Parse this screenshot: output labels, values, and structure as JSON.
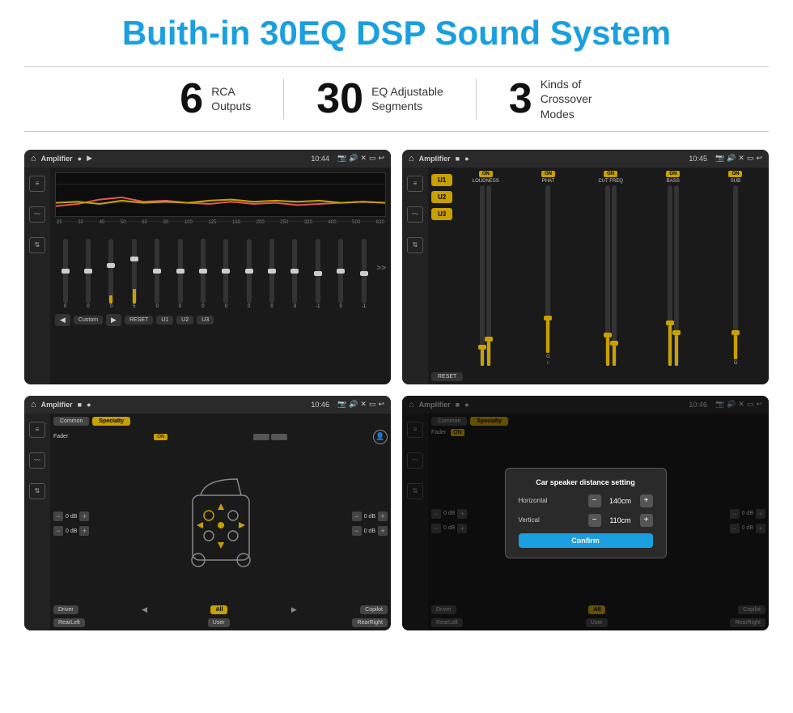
{
  "title": "Buith-in 30EQ DSP Sound System",
  "stats": [
    {
      "number": "6",
      "text": "RCA\nOutputs"
    },
    {
      "number": "30",
      "text": "EQ Adjustable\nSegments"
    },
    {
      "number": "3",
      "text": "Kinds of\nCrossover Modes"
    }
  ],
  "screen1": {
    "topbar": {
      "title": "Amplifier",
      "time": "10:44"
    },
    "eq_labels": [
      "25",
      "32",
      "40",
      "50",
      "63",
      "80",
      "100",
      "125",
      "160",
      "200",
      "250",
      "320",
      "400",
      "500",
      "630"
    ],
    "eq_values": [
      "0",
      "0",
      "0",
      "5",
      "0",
      "0",
      "0",
      "0",
      "0",
      "0",
      "0",
      "-1",
      "0",
      "-1"
    ],
    "buttons": [
      "Custom",
      "RESET",
      "U1",
      "U2",
      "U3"
    ]
  },
  "screen2": {
    "topbar": {
      "title": "Amplifier",
      "time": "10:45"
    },
    "u_buttons": [
      "U1",
      "U2",
      "U3"
    ],
    "channels": [
      "LOUDNESS",
      "PHAT",
      "CUT FREQ",
      "BASS",
      "SUB"
    ],
    "reset_label": "RESET"
  },
  "screen3": {
    "topbar": {
      "title": "Amplifier",
      "time": "10:46"
    },
    "tabs": [
      "Common",
      "Specialty"
    ],
    "fader_label": "Fader",
    "on_label": "ON",
    "db_values": [
      "0 dB",
      "0 dB",
      "0 dB",
      "0 dB"
    ],
    "bottom_btns": [
      "Driver",
      "Copilot",
      "RearLeft",
      "All",
      "User",
      "RearRight"
    ]
  },
  "screen4": {
    "topbar": {
      "title": "Amplifier",
      "time": "10:46"
    },
    "tabs": [
      "Common",
      "Specialty"
    ],
    "modal": {
      "title": "Car speaker distance setting",
      "horizontal_label": "Horizontal",
      "horizontal_value": "140cm",
      "vertical_label": "Vertical",
      "vertical_value": "110cm",
      "confirm_label": "Confirm"
    },
    "bottom_btns": [
      "Driver",
      "Copilot",
      "RearLeft",
      "All",
      "User",
      "RearRight"
    ]
  }
}
